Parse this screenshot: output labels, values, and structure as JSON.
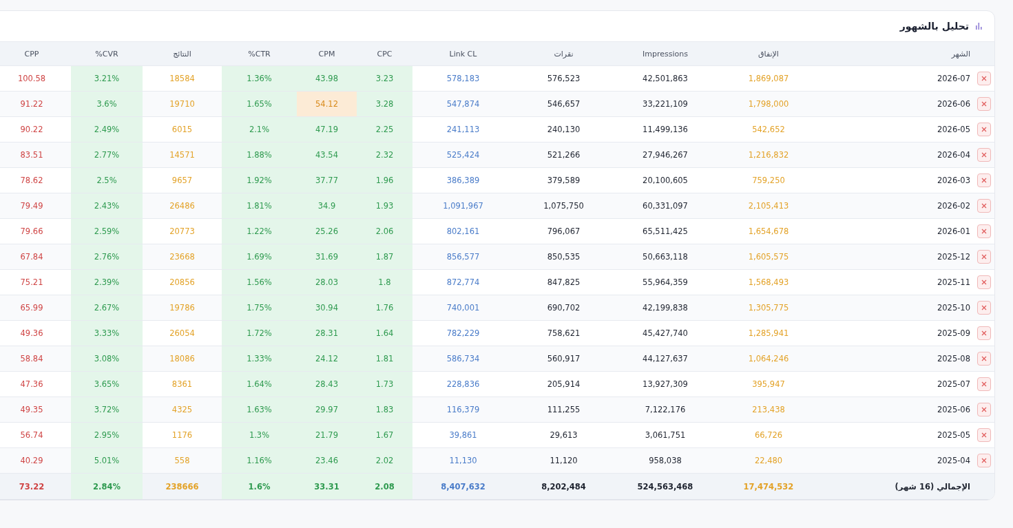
{
  "card": {
    "title": "تحليل بالشهور"
  },
  "table": {
    "columns": [
      {
        "label": "CPP",
        "kind": "cpp"
      },
      {
        "label": "%CVR",
        "kind": "metric"
      },
      {
        "label": "النتائج",
        "kind": "results"
      },
      {
        "label": "%CTR",
        "kind": "metric"
      },
      {
        "label": "CPM",
        "kind": "cpm"
      },
      {
        "label": "CPC",
        "kind": "metric"
      },
      {
        "label": "Link CL",
        "kind": "link"
      },
      {
        "label": "نقرات",
        "kind": "plain"
      },
      {
        "label": "Impressions",
        "kind": "plain"
      },
      {
        "label": "الإنفاق",
        "kind": "spend"
      },
      {
        "label": "الشهر",
        "kind": "month"
      }
    ],
    "rows": [
      {
        "cells": [
          "100.58",
          "3.21%",
          "18584",
          "1.36%",
          "43.98",
          "3.23",
          "578,183",
          "576,523",
          "42,501,863",
          "1,869,087",
          "2026-07"
        ],
        "cpm_alert": false
      },
      {
        "cells": [
          "91.22",
          "3.6%",
          "19710",
          "1.65%",
          "54.12",
          "3.28",
          "547,874",
          "546,657",
          "33,221,109",
          "1,798,000",
          "2026-06"
        ],
        "cpm_alert": true
      },
      {
        "cells": [
          "90.22",
          "2.49%",
          "6015",
          "2.1%",
          "47.19",
          "2.25",
          "241,113",
          "240,130",
          "11,499,136",
          "542,652",
          "2026-05"
        ],
        "cpm_alert": false
      },
      {
        "cells": [
          "83.51",
          "2.77%",
          "14571",
          "1.88%",
          "43.54",
          "2.32",
          "525,424",
          "521,266",
          "27,946,267",
          "1,216,832",
          "2026-04"
        ],
        "cpm_alert": false
      },
      {
        "cells": [
          "78.62",
          "2.5%",
          "9657",
          "1.92%",
          "37.77",
          "1.96",
          "386,389",
          "379,589",
          "20,100,605",
          "759,250",
          "2026-03"
        ],
        "cpm_alert": false
      },
      {
        "cells": [
          "79.49",
          "2.43%",
          "26486",
          "1.81%",
          "34.9",
          "1.93",
          "1,091,967",
          "1,075,750",
          "60,331,097",
          "2,105,413",
          "2026-02"
        ],
        "cpm_alert": false
      },
      {
        "cells": [
          "79.66",
          "2.59%",
          "20773",
          "1.22%",
          "25.26",
          "2.06",
          "802,161",
          "796,067",
          "65,511,425",
          "1,654,678",
          "2026-01"
        ],
        "cpm_alert": false
      },
      {
        "cells": [
          "67.84",
          "2.76%",
          "23668",
          "1.69%",
          "31.69",
          "1.87",
          "856,577",
          "850,535",
          "50,663,118",
          "1,605,575",
          "2025-12"
        ],
        "cpm_alert": false
      },
      {
        "cells": [
          "75.21",
          "2.39%",
          "20856",
          "1.56%",
          "28.03",
          "1.8",
          "872,774",
          "847,825",
          "55,964,359",
          "1,568,493",
          "2025-11"
        ],
        "cpm_alert": false
      },
      {
        "cells": [
          "65.99",
          "2.67%",
          "19786",
          "1.75%",
          "30.94",
          "1.76",
          "740,001",
          "690,702",
          "42,199,838",
          "1,305,775",
          "2025-10"
        ],
        "cpm_alert": false
      },
      {
        "cells": [
          "49.36",
          "3.33%",
          "26054",
          "1.72%",
          "28.31",
          "1.64",
          "782,229",
          "758,621",
          "45,427,740",
          "1,285,941",
          "2025-09"
        ],
        "cpm_alert": false
      },
      {
        "cells": [
          "58.84",
          "3.08%",
          "18086",
          "1.33%",
          "24.12",
          "1.81",
          "586,734",
          "560,917",
          "44,127,637",
          "1,064,246",
          "2025-08"
        ],
        "cpm_alert": false
      },
      {
        "cells": [
          "47.36",
          "3.65%",
          "8361",
          "1.64%",
          "28.43",
          "1.73",
          "228,836",
          "205,914",
          "13,927,309",
          "395,947",
          "2025-07"
        ],
        "cpm_alert": false
      },
      {
        "cells": [
          "49.35",
          "3.72%",
          "4325",
          "1.63%",
          "29.97",
          "1.83",
          "116,379",
          "111,255",
          "7,122,176",
          "213,438",
          "2025-06"
        ],
        "cpm_alert": false
      },
      {
        "cells": [
          "56.74",
          "2.95%",
          "1176",
          "1.3%",
          "21.79",
          "1.67",
          "39,861",
          "29,613",
          "3,061,751",
          "66,726",
          "2025-05"
        ],
        "cpm_alert": false
      },
      {
        "cells": [
          "40.29",
          "5.01%",
          "558",
          "1.16%",
          "23.46",
          "2.02",
          "11,130",
          "11,120",
          "958,038",
          "22,480",
          "2025-04"
        ],
        "cpm_alert": false
      }
    ],
    "totals": {
      "cells": [
        "73.22",
        "2.84%",
        "238666",
        "1.6%",
        "33.31",
        "2.08",
        "8,407,632",
        "8,202,484",
        "524,563,468",
        "17,474,532",
        "الإجمالي (16 شهر)"
      ]
    }
  }
}
